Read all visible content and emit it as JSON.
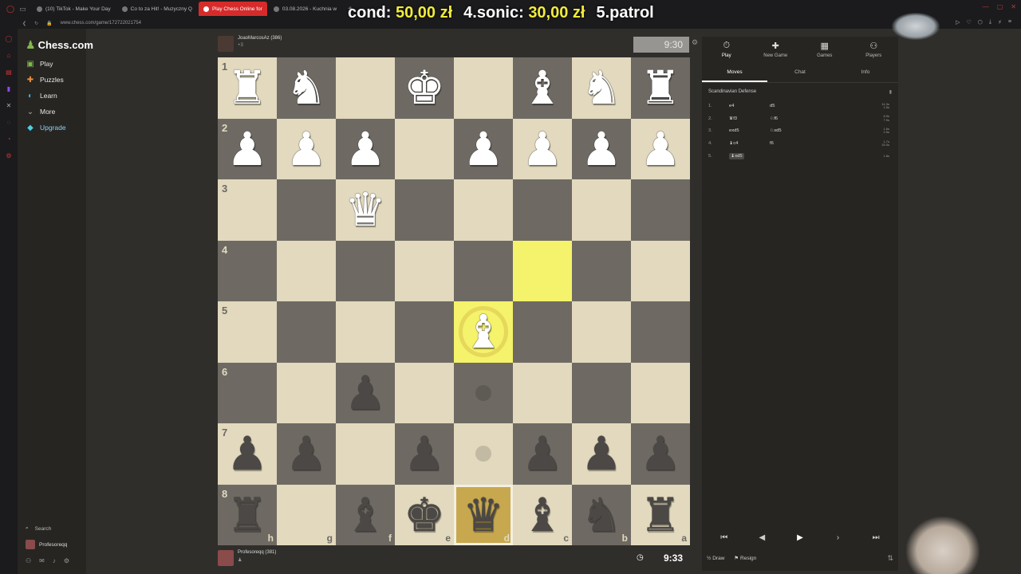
{
  "browser": {
    "tabs": [
      {
        "label": "(10) TikTok - Make Your Day",
        "active": false
      },
      {
        "label": "Co to za Hit! - Muzyczny Q",
        "active": false
      },
      {
        "label": "Play Chess Online for",
        "active": true
      },
      {
        "label": "03.08.2026 - Kuchnia w",
        "active": false
      }
    ],
    "new_tab": "+",
    "url": "www.chess.com/game/172722021754"
  },
  "overlay": {
    "entries": [
      {
        "label": "cond:",
        "amount": "50,00 zł"
      },
      {
        "label": "4.sonic:",
        "amount": "30,00 zł"
      },
      {
        "label": "5.patrol",
        "amount": ""
      }
    ]
  },
  "nav": {
    "logo": "Chess.com",
    "items": [
      {
        "label": "Play",
        "icon": "play-icon",
        "glyph": "▣"
      },
      {
        "label": "Puzzles",
        "icon": "puzzle-icon",
        "glyph": "✚"
      },
      {
        "label": "Learn",
        "icon": "learn-icon",
        "glyph": "◐"
      },
      {
        "label": "More",
        "icon": "chevron-down-icon",
        "glyph": "⌄"
      }
    ],
    "upgrade": "Upgrade",
    "search": "Search",
    "user": "Profesoreqq"
  },
  "players": {
    "top": {
      "name": "JoaoMarcosAz (386)",
      "sub": "+3",
      "clock": "9:30"
    },
    "bottom": {
      "name": "Profesoreqq (381)",
      "sub": "♟",
      "clock": "9:33"
    }
  },
  "board": {
    "ranks": [
      "1",
      "2",
      "3",
      "4",
      "5",
      "6",
      "7",
      "8"
    ],
    "files": [
      "h",
      "g",
      "f",
      "e",
      "d",
      "c",
      "b",
      "a"
    ],
    "rows": [
      [
        "wR",
        "wN",
        "",
        "wK",
        "",
        "wB",
        "wN",
        "wR"
      ],
      [
        "wP",
        "wP",
        "wP",
        "",
        "wP",
        "wP",
        "wP",
        "wP"
      ],
      [
        "",
        "",
        "wQ",
        "",
        "",
        "",
        "",
        ""
      ],
      [
        "",
        "",
        "",
        "",
        "",
        "",
        "",
        ""
      ],
      [
        "",
        "",
        "",
        "",
        "wB",
        "",
        "",
        ""
      ],
      [
        "",
        "",
        "bP",
        "",
        "",
        "",
        "",
        ""
      ],
      [
        "bP",
        "bP",
        "",
        "bP",
        "",
        "bP",
        "bP",
        "bP"
      ],
      [
        "bR",
        "",
        "bB",
        "bK",
        "bQ",
        "bB",
        "bN",
        "bR"
      ]
    ],
    "highlight": [
      [
        3,
        5
      ],
      [
        4,
        4
      ]
    ],
    "selected": [
      7,
      4
    ],
    "hints": [
      [
        5,
        4
      ],
      [
        6,
        4
      ]
    ]
  },
  "panel": {
    "tabs": [
      {
        "label": "Play",
        "icon": "clock-icon",
        "glyph": "⏱"
      },
      {
        "label": "New Game",
        "icon": "plus-icon",
        "glyph": "✚"
      },
      {
        "label": "Games",
        "icon": "games-icon",
        "glyph": "▦"
      },
      {
        "label": "Players",
        "icon": "players-icon",
        "glyph": "👥"
      }
    ],
    "subtabs": [
      "Moves",
      "Chat",
      "Info"
    ],
    "opening": "Scandinavian Defense",
    "moves": [
      {
        "n": "1.",
        "w": "e4",
        "b": "d5",
        "t1": "14.3s",
        "t2": "1.5s"
      },
      {
        "n": "2.",
        "w": "♛f3",
        "b": "♘f6",
        "t1": "8.9s",
        "t2": "7.9s"
      },
      {
        "n": "3.",
        "w": "exd5",
        "b": "♘xd5",
        "t1": "1.6s",
        "t2": "2.5s"
      },
      {
        "n": "4.",
        "w": "♝c4",
        "b": "f6",
        "t1": "1.7s",
        "t2": "15.0s"
      },
      {
        "n": "5.",
        "w": "♝xd5",
        "b": "",
        "t1": "1.8s",
        "t2": ""
      }
    ],
    "draw": "Draw",
    "resign": "Resign"
  }
}
